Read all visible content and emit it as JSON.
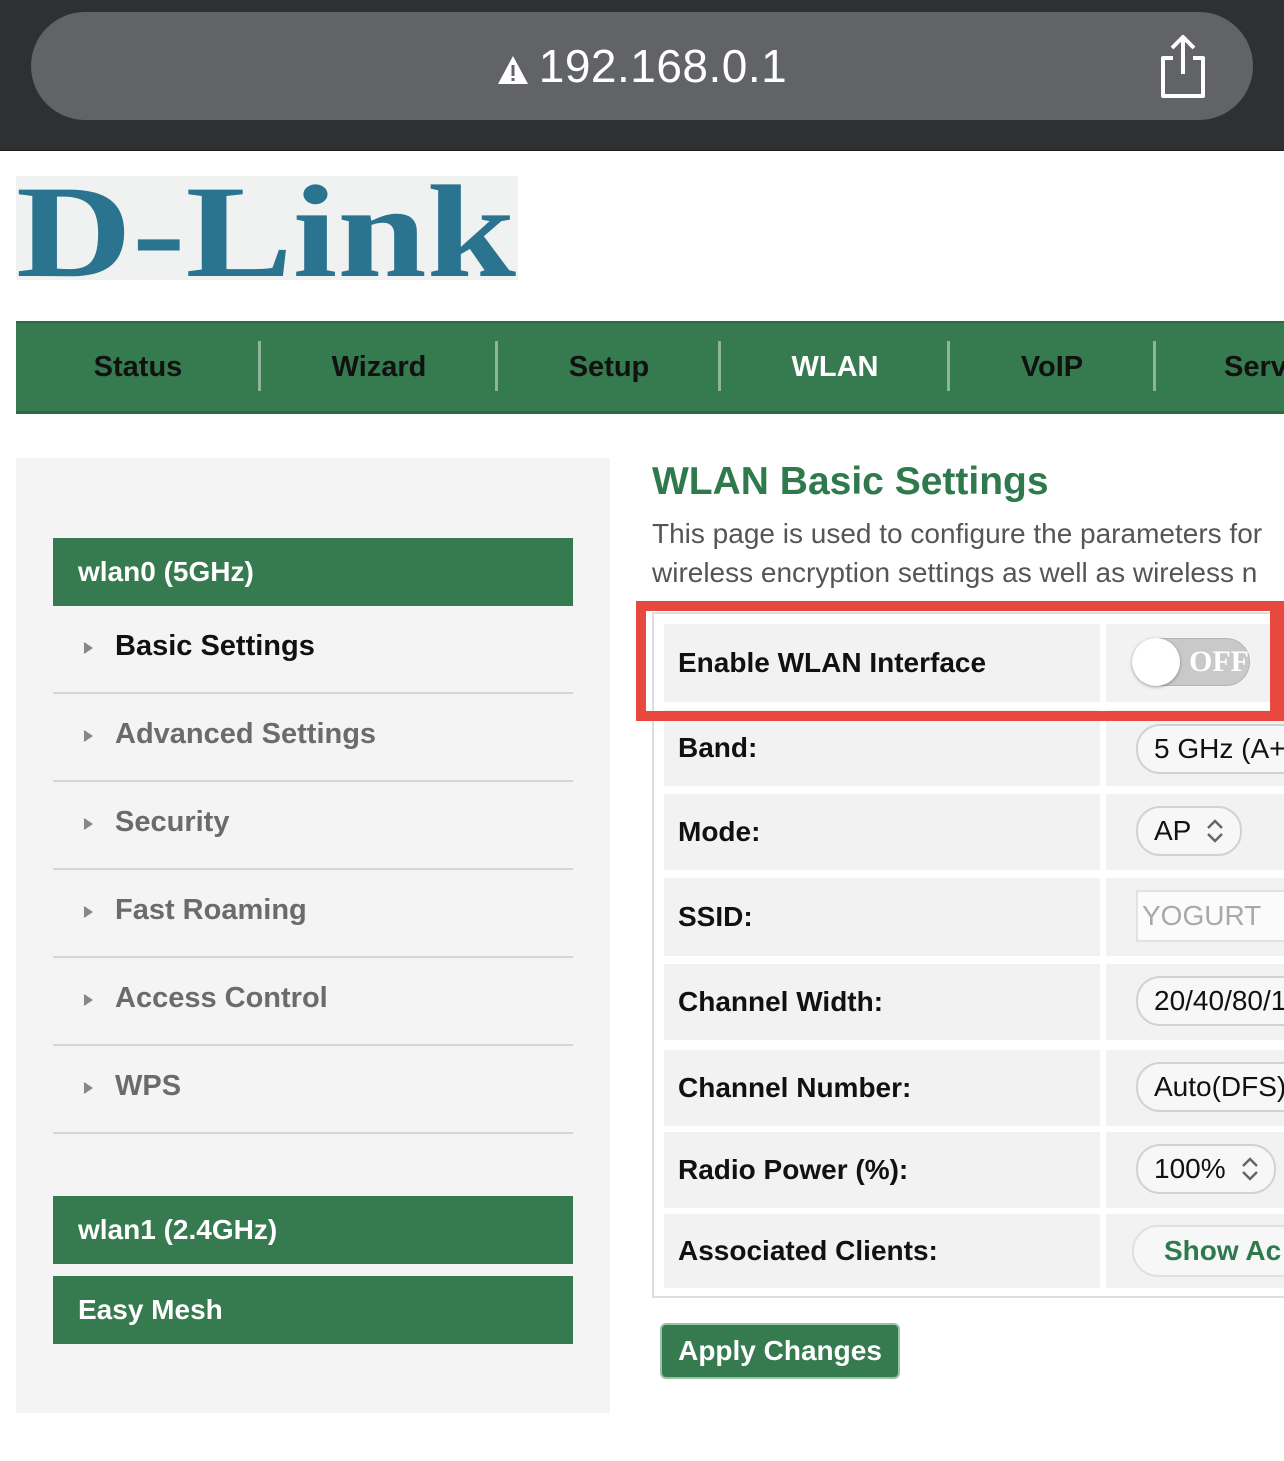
{
  "browser": {
    "url": "192.168.0.1",
    "url_icon": "warning-triangle-icon",
    "share_icon": "share-icon"
  },
  "logo": {
    "text": "D-Link"
  },
  "topnav": {
    "items": [
      {
        "label": "Status"
      },
      {
        "label": "Wizard"
      },
      {
        "label": "Setup"
      },
      {
        "label": "WLAN",
        "active": true
      },
      {
        "label": "VoIP"
      },
      {
        "label": "Serv"
      }
    ]
  },
  "sidebar": {
    "wlan0_header": "wlan0 (5GHz)",
    "items": [
      {
        "label": "Basic Settings",
        "active": true
      },
      {
        "label": "Advanced Settings"
      },
      {
        "label": "Security"
      },
      {
        "label": "Fast Roaming"
      },
      {
        "label": "Access Control"
      },
      {
        "label": "WPS"
      }
    ],
    "wlan1_header": "wlan1 (2.4GHz)",
    "mesh_header": "Easy Mesh"
  },
  "main": {
    "title": "WLAN Basic Settings",
    "description_line1": "This page is used to configure the parameters for",
    "description_line2": "wireless encryption settings as well as wireless n",
    "enable_label": "Enable WLAN Interface",
    "enable_state": "OFF",
    "band_label": "Band:",
    "band_value": "5 GHz (A+",
    "mode_label": "Mode:",
    "mode_value": "AP",
    "ssid_label": "SSID:",
    "ssid_value": "YOGURT",
    "channel_width_label": "Channel Width:",
    "channel_width_value": "20/40/80/1",
    "channel_number_label": "Channel Number:",
    "channel_number_value": "Auto(DFS)",
    "radio_power_label": "Radio Power (%):",
    "radio_power_value": "100%",
    "clients_label": "Associated Clients:",
    "clients_button": "Show Ac",
    "apply_button": "Apply Changes"
  },
  "colors": {
    "brand_green": "#367a4f",
    "title_green": "#2f7a4c",
    "highlight_red": "#e8493e",
    "logo_blue": "#2b7490"
  }
}
